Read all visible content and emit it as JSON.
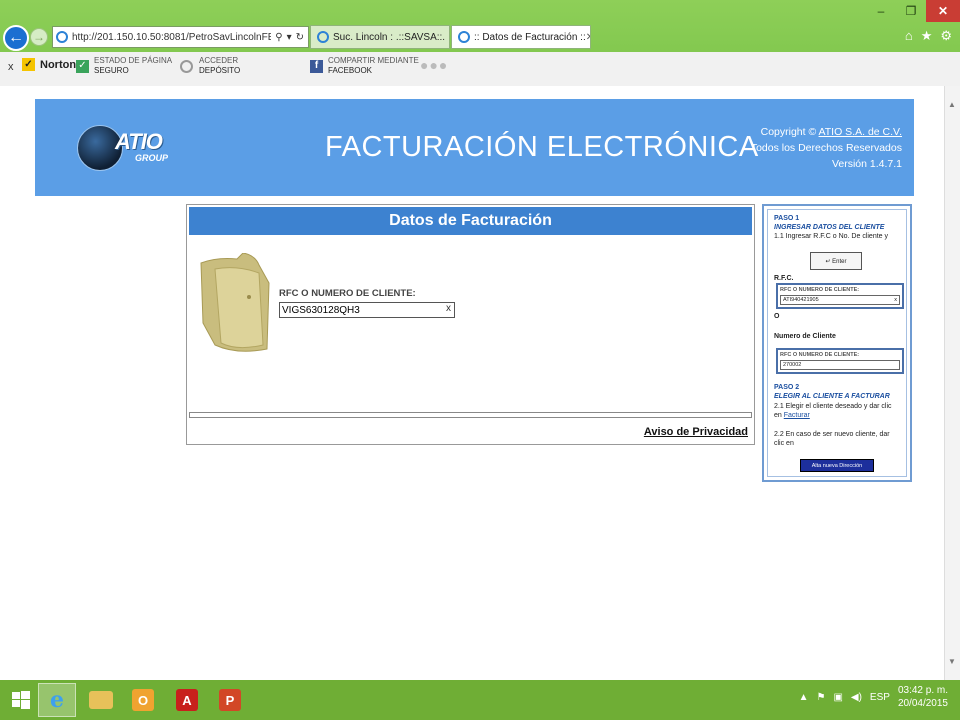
{
  "browser": {
    "url": "http://201.150.10.50:8081/PetroSavLincolnFE/FEDatosF",
    "tabs": [
      {
        "label": "Suc. Lincoln : .::SAVSA::."
      },
      {
        "label": ":: Datos de Facturación ::"
      }
    ],
    "window_controls": {
      "minimize": "–",
      "maximize": "❐",
      "close": "✕"
    }
  },
  "norton_bar": {
    "close": "x",
    "brand": "Norton",
    "items": [
      {
        "top": "ESTADO DE PÁGINA",
        "bottom": "SEGURO"
      },
      {
        "top": "ACCEDER",
        "bottom": "DEPÓSITO"
      },
      {
        "top": "COMPARTIR MEDIANTE",
        "bottom": "FACEBOOK"
      }
    ],
    "more": "●●●"
  },
  "banner": {
    "logo_text": "ATIO",
    "logo_sub": "GROUP",
    "title": "FACTURACIÓN ELECTRÓNICA",
    "copyright_prefix": "Copyright © ",
    "copyright_company": "ATIO S.A. de C.V.",
    "rights": "Todos los Derechos Reservados",
    "version": "Versión 1.4.7.1"
  },
  "form": {
    "heading": "Datos de Facturación",
    "field_label": "RFC O NUMERO DE CLIENTE:",
    "field_value": "VIGS630128QH3",
    "clear": "x",
    "privacy_link": "Aviso de Privacidad"
  },
  "help": {
    "paso1": "PASO 1",
    "paso1_title": "INGRESAR DATOS DEL CLIENTE",
    "step_1_1": "1.1    Ingresar R.F.C o No. De cliente y",
    "enter_key": "↵ Enter",
    "rfc_label": "R.F.C.",
    "mini_label": "RFC O NUMERO DE CLIENTE:",
    "mini_rfc_value": "ATI940421905",
    "mini_clear": "x",
    "o": "O",
    "client_number_label": "Numero de Cliente",
    "mini_client_value": "270002",
    "paso2": "PASO 2",
    "paso2_title": "ELEGIR AL CLIENTE A FACTURAR",
    "step_2_1": "2.1    Elegir el cliente deseado y dar clic",
    "step_2_1b_prefix": "en ",
    "step_2_1b_link": "Facturar",
    "step_2_2": "2.2    En caso de ser nuevo cliente, dar",
    "step_2_2b": "clic en",
    "alta_button": "Alta nueva Dirección"
  },
  "taskbar": {
    "language": "ESP",
    "time": "03:42 p. m.",
    "date": "20/04/2015"
  }
}
